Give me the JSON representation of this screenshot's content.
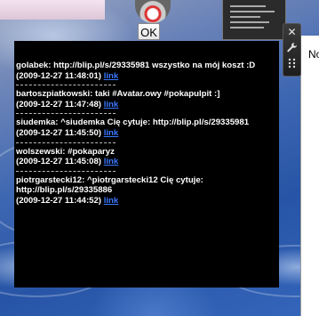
{
  "ok_label": "OK",
  "right_window_text": "No",
  "messages": [
    {
      "text": "golabek: http://blip.pl/s/29335981 wszystko na mój koszt :D",
      "time": "(2009-12-27 11:48:01)",
      "link": "link"
    },
    {
      "text": "bartoszpiatkowski: taki #Avatar.owy #pokapulpit :]",
      "time": "(2009-12-27 11:47:48)",
      "link": "link"
    },
    {
      "text": "siudemka: ^siudemka Cię cytuje: http://blip.pl/s/29335981",
      "time": "(2009-12-27 11:45:50)",
      "link": "link"
    },
    {
      "text": "wolszewski: #pokaparyz",
      "time": "(2009-12-27 11:45:08)",
      "link": "link"
    },
    {
      "text": "piotrgarstecki12: ^piotrgarstecki12 Cię cytuje: http://blip.pl/s/29335886",
      "time": "(2009-12-27 11:44:52)",
      "link": "link"
    }
  ],
  "toolbar": {
    "close_icon": "close-icon",
    "settings_icon": "wrench-icon",
    "drag_icon": "drag-handle-icon"
  },
  "colors": {
    "panel_bg": "#000000",
    "link": "#3b78ff",
    "text": "#ffffff"
  }
}
